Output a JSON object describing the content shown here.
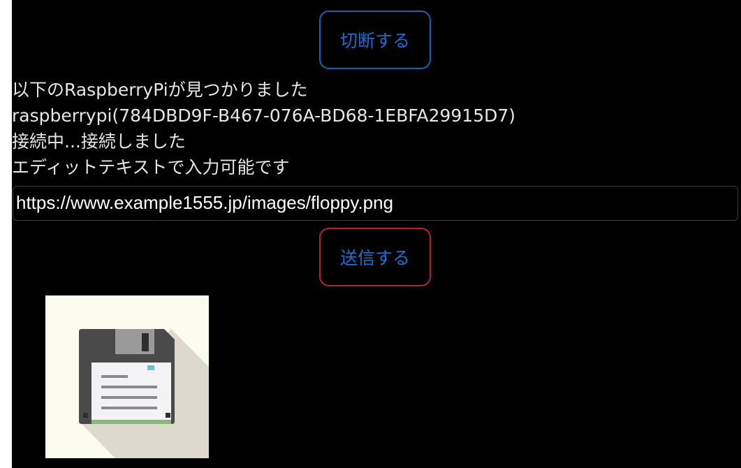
{
  "buttons": {
    "disconnect_label": "切断する",
    "send_label": "送信する"
  },
  "log": {
    "lines": [
      "以下のRaspberryPiが見つかりました",
      "raspberrypi(784DBD9F-B467-076A-BD68-1EBFA29915D7)",
      "接続中...接続しました",
      "エディットテキストで入力可能です"
    ]
  },
  "edit_text": {
    "value": "https://www.example1555.jp/images/floppy.png"
  },
  "image": {
    "icon": "floppy-disk-icon"
  },
  "colors": {
    "background": "#000000",
    "disconnect_border": "#1a5fb8",
    "send_border": "#b8202c",
    "button_text": "#1a6fd6",
    "log_text": "#e6e6e6"
  }
}
